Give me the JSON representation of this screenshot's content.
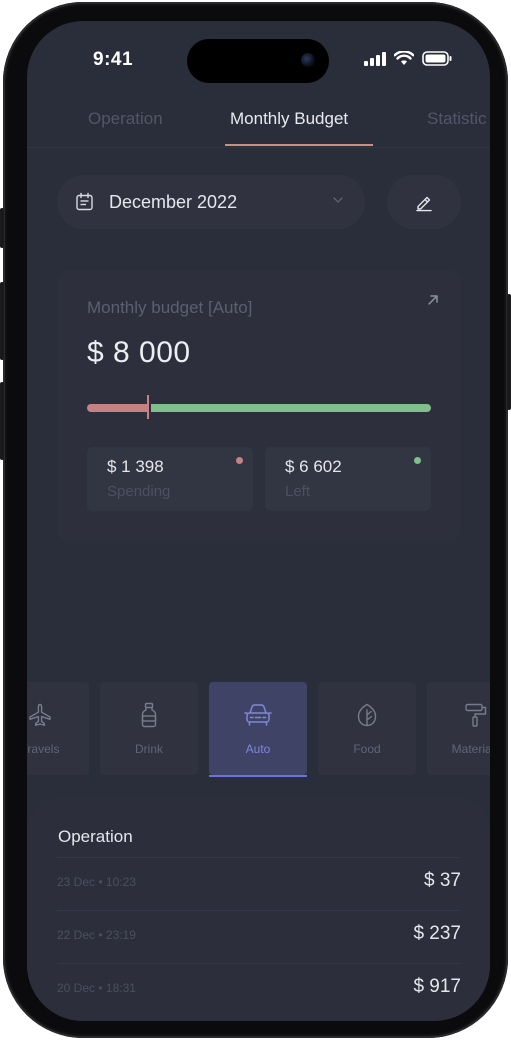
{
  "status_bar": {
    "time": "9:41"
  },
  "tabs": [
    {
      "label": "Operation",
      "active": false
    },
    {
      "label": "Monthly Budget",
      "active": true
    },
    {
      "label": "Statistic",
      "active": false
    }
  ],
  "period": {
    "label": "December 2022"
  },
  "budget": {
    "title": "Monthly budget [Auto]",
    "amount": "$ 8 000",
    "spent_fraction": 0.175,
    "spending": {
      "value": "$ 1 398",
      "label": "Spending"
    },
    "left": {
      "value": "$ 6 602",
      "label": "Left"
    }
  },
  "categories": [
    {
      "label": "Travels",
      "icon": "plane-icon",
      "active": false
    },
    {
      "label": "Drink",
      "icon": "bottle-icon",
      "active": false
    },
    {
      "label": "Auto",
      "icon": "car-icon",
      "active": true
    },
    {
      "label": "Food",
      "icon": "leaf-icon",
      "active": false
    },
    {
      "label": "Materials",
      "icon": "paint-roller-icon",
      "active": false
    }
  ],
  "operations": {
    "title": "Operation",
    "items": [
      {
        "date": "23 Dec • 10:23",
        "amount": "$ 37"
      },
      {
        "date": "22 Dec • 23:19",
        "amount": "$ 237"
      },
      {
        "date": "20 Dec • 18:31",
        "amount": "$ 917"
      }
    ]
  },
  "colors": {
    "spending": "#c68282",
    "left": "#7fbf8c",
    "accent": "#6c73d8",
    "tab_underline": "#c9907a"
  }
}
